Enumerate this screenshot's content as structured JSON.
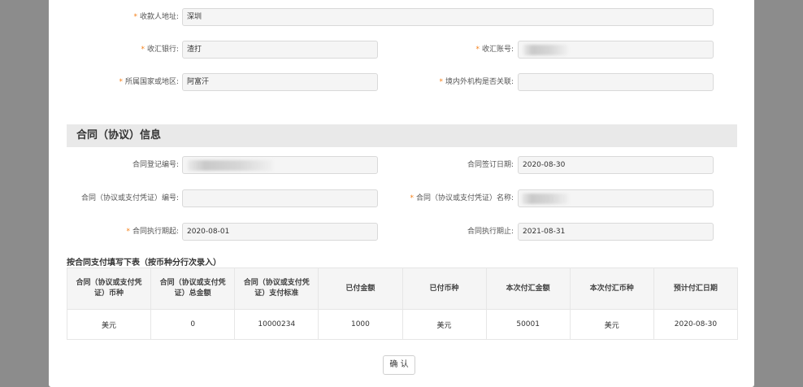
{
  "receiver": {
    "address_label": "收款人地址:",
    "address_value": "深圳",
    "bank_label": "收汇银行:",
    "bank_value": "渣打",
    "account_label": "收汇账号:",
    "country_label": "所属国家或地区:",
    "country_value": "阿富汗",
    "related_label": "境内外机构是否关联:",
    "related_value": ""
  },
  "contract": {
    "section_title": "合同（协议）信息",
    "reg_no_label": "合同登记编号:",
    "sign_date_label": "合同签订日期:",
    "sign_date_value": "2020-08-30",
    "voucher_no_label": "合同（协议或支付凭证）编号:",
    "voucher_no_value": "",
    "voucher_name_label": "合同（协议或支付凭证）名称:",
    "exec_start_label": "合同执行期起:",
    "exec_start_value": "2020-08-01",
    "exec_end_label": "合同执行期止:",
    "exec_end_value": "2021-08-31"
  },
  "payment_table": {
    "caption": "按合同支付填写下表（按币种分行次录入）",
    "headers": [
      "合同（协议或支付凭证）币种",
      "合同（协议或支付凭证）总金额",
      "合同（协议或支付凭证）支付标准",
      "已付金额",
      "已付币种",
      "本次付汇金额",
      "本次付汇币种",
      "预计付汇日期"
    ],
    "rows": [
      [
        "美元",
        "0",
        "10000234",
        "1000",
        "美元",
        "50001",
        "美元",
        "2020-08-30"
      ]
    ]
  },
  "actions": {
    "confirm_label": "确 认"
  },
  "colors": {
    "required_star": "#f57f17",
    "section_bg": "#e9e9e9",
    "input_bg": "#f5f5f5",
    "overlay": "#8c8c8c"
  }
}
